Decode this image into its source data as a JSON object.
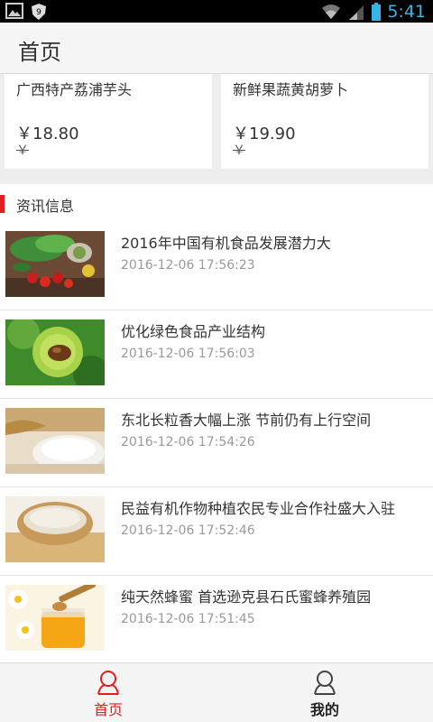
{
  "status_bar": {
    "time": "5:41"
  },
  "header": {
    "title": "首页"
  },
  "products": [
    {
      "name": "广西特产荔浦芋头",
      "price": "￥18.80",
      "old_price": "￥"
    },
    {
      "name": "新鲜果蔬黄胡萝卜",
      "price": "￥19.90",
      "old_price": "￥"
    }
  ],
  "news_section": {
    "label": "资讯信息"
  },
  "news": [
    {
      "title": "2016年中国有机食品发展潜力大",
      "time": "2016-12-06 17:56:23"
    },
    {
      "title": "优化绿色食品产业结构",
      "time": "2016-12-06 17:56:03"
    },
    {
      "title": "东北长粒香大幅上涨 节前仍有上行空间",
      "time": "2016-12-06 17:54:26"
    },
    {
      "title": "民益有机作物种植农民专业合作社盛大入驻",
      "time": "2016-12-06 17:52:46"
    },
    {
      "title": "纯天然蜂蜜 首选逊克县石氏蜜蜂养殖园",
      "time": "2016-12-06 17:51:45"
    }
  ],
  "tabs": [
    {
      "label": "首页",
      "icon": "home-person-icon",
      "active": true
    },
    {
      "label": "我的",
      "icon": "profile-person-icon",
      "active": false
    }
  ],
  "colors": {
    "accent": "#e02020",
    "status_blue": "#33b5e5"
  }
}
